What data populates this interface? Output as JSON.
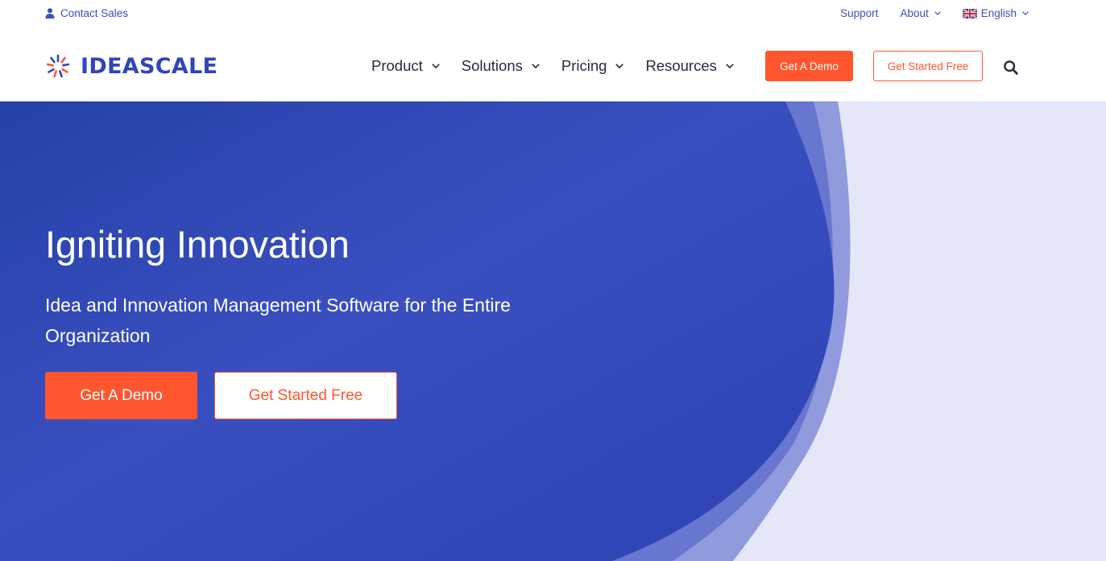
{
  "utility_bar": {
    "contact_sales": "Contact Sales",
    "support": "Support",
    "about": "About",
    "language": "English"
  },
  "brand": {
    "name": "IDEASCALE",
    "primary_color": "#3346b6",
    "accent_color": "#ff5630"
  },
  "nav": {
    "items": [
      {
        "label": "Product",
        "icon": "chevron-down-icon"
      },
      {
        "label": "Solutions",
        "icon": "chevron-down-icon"
      },
      {
        "label": "Pricing",
        "icon": "chevron-down-icon"
      },
      {
        "label": "Resources",
        "icon": "chevron-down-icon"
      }
    ],
    "demo_button": "Get A Demo",
    "free_button": "Get Started Free",
    "search_icon": "search-icon"
  },
  "hero": {
    "title": "Igniting Innovation",
    "subtitle": "Idea and Innovation Management Software for the Entire Organization",
    "demo_button": "Get A Demo",
    "free_button": "Get Started Free",
    "background_color": "#2f44b5",
    "side_color": "#e4e7f7"
  }
}
